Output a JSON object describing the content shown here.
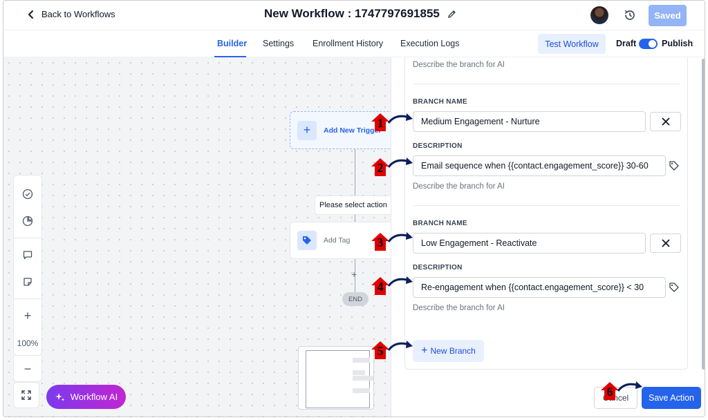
{
  "header": {
    "back_label": "Back to Workflows",
    "title": "New Workflow : 1747797691855",
    "saved_label": "Saved"
  },
  "tabs": [
    {
      "label": "Builder",
      "active": true
    },
    {
      "label": "Settings"
    },
    {
      "label": "Enrollment History"
    },
    {
      "label": "Execution Logs"
    }
  ],
  "actions": {
    "test_workflow": "Test Workflow",
    "draft_label": "Draft",
    "publish_label": "Publish",
    "publish_on": true
  },
  "canvas": {
    "trigger_label": "Add New Trigger",
    "action_select": "Please select action",
    "tag_node_label": "Add Tag",
    "end_label": "END",
    "zoom": "100%",
    "ai_button": "Workflow AI"
  },
  "panel": {
    "top_helper": "Describe the branch for AI",
    "branches": [
      {
        "name_label": "BRANCH NAME",
        "name_value": "Medium Engagement - Nurture",
        "desc_label": "DESCRIPTION",
        "desc_value": "Email sequence when  {{contact.engagement_score}} 30-60 ",
        "helper": "Describe the branch for AI"
      },
      {
        "name_label": "BRANCH NAME",
        "name_value": "Low Engagement - Reactivate",
        "desc_label": "DESCRIPTION",
        "desc_value": "Re-engagement when {{contact.engagement_score}} < 30",
        "helper": "Describe the branch for AI"
      }
    ],
    "new_branch": "New Branch",
    "cancel": "Cancel",
    "save_action": "Save Action"
  },
  "annotations": [
    "1",
    "2",
    "3",
    "4",
    "5",
    "6"
  ],
  "colors": {
    "accent": "#2563eb",
    "annotation_marker": "#e00000",
    "annotation_arrow": "#0b1f5c",
    "ai_gradient_start": "#7c3aed",
    "ai_gradient_end": "#c026d3"
  }
}
